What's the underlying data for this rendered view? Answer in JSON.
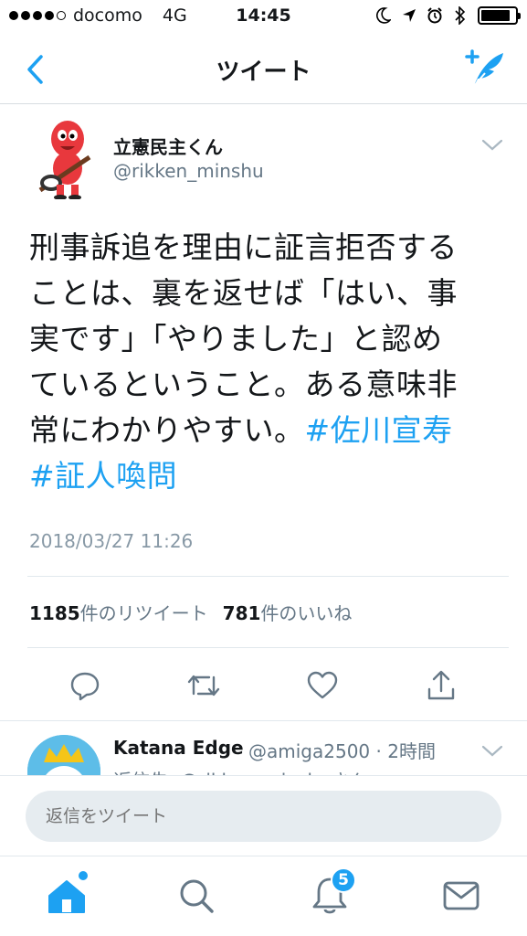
{
  "status_bar": {
    "carrier": "docomo",
    "network": "4G",
    "time": "14:45",
    "signal_bars_filled": 4,
    "signal_bars_total": 5,
    "battery_level": 0.85
  },
  "nav": {
    "title": "ツイート",
    "back_icon": "chevron-left-icon",
    "compose_icon": "compose-feather-icon"
  },
  "tweet": {
    "author_name": "立憲民主くん",
    "author_handle": "@rikken_minshu",
    "lines": [
      "刑事訴追を理由に証言拒否する",
      "ことは、裏を返せば「はい、事",
      "実です」「やりました」と認め",
      "ているということ。ある意味非"
    ],
    "line5_text": "常にわかりやすい。",
    "hashtag1": "#佐川宣寿",
    "hashtag2": "#証人喚問",
    "date": "2018/03/27 11:26",
    "retweet_count": "1185",
    "retweet_label": "件のリツイート",
    "like_count": "781",
    "like_label": "件のいいね"
  },
  "reply": {
    "name": "Katana Edge",
    "meta": "@amiga2500 · 2時間",
    "line2": "返信先: @rikken_minshuさん"
  },
  "reply_bar": {
    "placeholder": "返信をツイート"
  },
  "tabs": {
    "notifications_badge": "5"
  },
  "colors": {
    "accent": "#1da1f2",
    "text": "#14171a",
    "muted": "#657786",
    "divider": "#e1e8ed"
  }
}
